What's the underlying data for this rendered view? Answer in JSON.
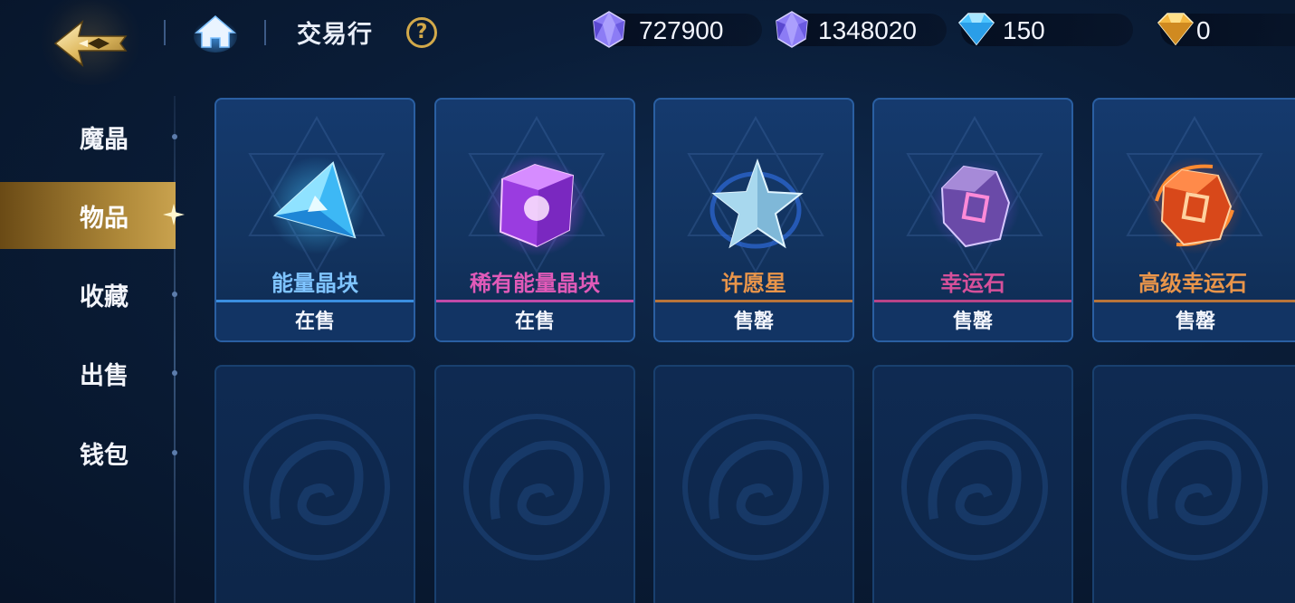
{
  "header": {
    "title": "交易行",
    "help_label": "?",
    "currencies": [
      {
        "name": "crystal-bound",
        "value": "727900",
        "color": "#7b6cf0"
      },
      {
        "name": "crystal",
        "value": "1348020",
        "color": "#7b6cf0"
      },
      {
        "name": "diamond",
        "value": "150",
        "color": "#3fb8ff"
      },
      {
        "name": "gold-diamond",
        "value": "0",
        "color": "#f0b040"
      }
    ]
  },
  "sidebar": {
    "items": [
      {
        "label": "魔晶",
        "active": false
      },
      {
        "label": "物品",
        "active": true
      },
      {
        "label": "收藏",
        "active": false
      },
      {
        "label": "出售",
        "active": false
      },
      {
        "label": "钱包",
        "active": false
      }
    ]
  },
  "grid": {
    "items": [
      {
        "name": "能量晶块",
        "status": "在售",
        "name_color": "#7fc4ff",
        "divider_color": "#3a8ee0",
        "icon": "blue-crystal-icon"
      },
      {
        "name": "稀有能量晶块",
        "status": "在售",
        "name_color": "#e05ab8",
        "divider_color": "#c04aa8",
        "icon": "purple-cube-icon"
      },
      {
        "name": "许愿星",
        "status": "售罄",
        "name_color": "#e9954a",
        "divider_color": "#b8743a",
        "icon": "wish-star-icon"
      },
      {
        "name": "幸运石",
        "status": "售罄",
        "name_color": "#d6509a",
        "divider_color": "#b84488",
        "icon": "lucky-stone-icon"
      },
      {
        "name": "高级幸运石",
        "status": "售罄",
        "name_color": "#e9954a",
        "divider_color": "#b8743a",
        "icon": "advanced-lucky-stone-icon"
      }
    ],
    "empty_slots": 5
  }
}
